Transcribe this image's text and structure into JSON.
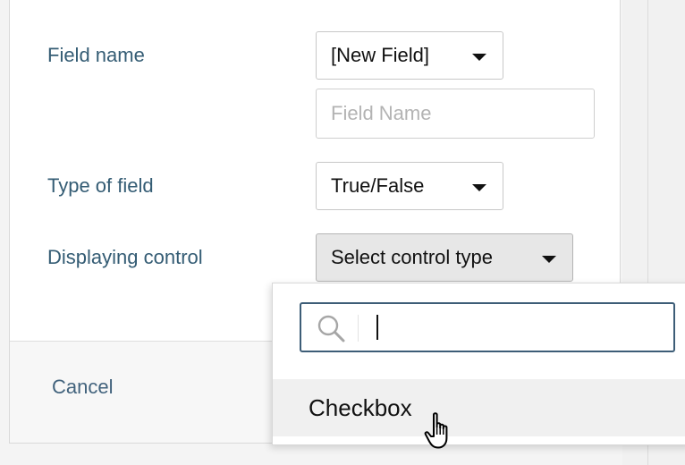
{
  "form": {
    "field_name_label": "Field name",
    "field_name_select": "[New Field]",
    "field_name_placeholder": "Field Name",
    "field_type_label": "Type of field",
    "field_type_select": "True/False",
    "control_label": "Displaying control",
    "control_select": "Select control type"
  },
  "footer": {
    "cancel_label": "Cancel"
  },
  "dropdown": {
    "search_value": "",
    "search_icon": "search-icon",
    "options": [
      {
        "label": "Checkbox"
      }
    ]
  },
  "colors": {
    "label": "#345c74",
    "cancel": "#42637d",
    "search_border": "#3d5d77",
    "option_hover": "#f0f0f0"
  }
}
